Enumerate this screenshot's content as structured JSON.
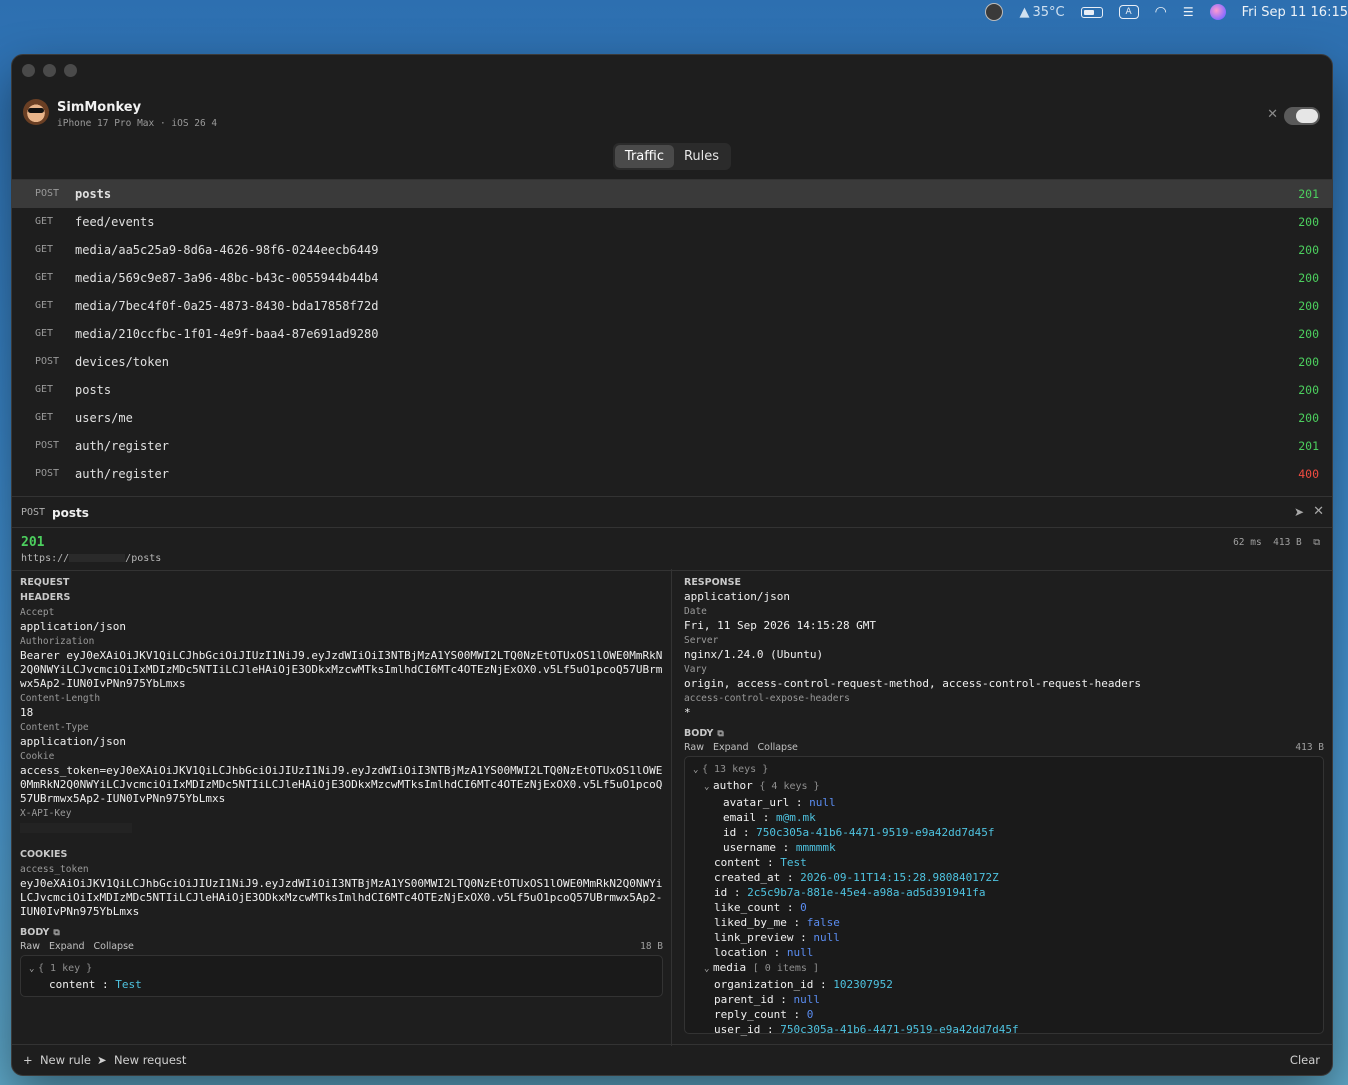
{
  "menubar": {
    "temperature": "35°C",
    "input_source": "A",
    "datetime": "Fri Sep 11  16:15"
  },
  "app": {
    "name": "SimMonkey",
    "device": "iPhone 17 Pro Max · iOS 26 4"
  },
  "tabs": [
    {
      "label": "Traffic",
      "active": true
    },
    {
      "label": "Rules",
      "active": false
    }
  ],
  "traffic": [
    {
      "method": "POST",
      "path": "posts",
      "status": "201"
    },
    {
      "method": "GET",
      "path": "feed/events",
      "status": "200"
    },
    {
      "method": "GET",
      "path": "media/aa5c25a9-8d6a-4626-98f6-0244eecb6449",
      "status": "200"
    },
    {
      "method": "GET",
      "path": "media/569c9e87-3a96-48bc-b43c-0055944b44b4",
      "status": "200"
    },
    {
      "method": "GET",
      "path": "media/7bec4f0f-0a25-4873-8430-bda17858f72d",
      "status": "200"
    },
    {
      "method": "GET",
      "path": "media/210ccfbc-1f01-4e9f-baa4-87e691ad9280",
      "status": "200"
    },
    {
      "method": "POST",
      "path": "devices/token",
      "status": "200"
    },
    {
      "method": "GET",
      "path": "posts",
      "status": "200"
    },
    {
      "method": "GET",
      "path": "users/me",
      "status": "200"
    },
    {
      "method": "POST",
      "path": "auth/register",
      "status": "201"
    },
    {
      "method": "POST",
      "path": "auth/register",
      "status": "400"
    }
  ],
  "detail": {
    "method": "POST",
    "path": "posts",
    "status": "201",
    "url_prefix": "https://",
    "url_suffix": "/posts",
    "duration": "62 ms",
    "size": "413 B"
  },
  "request": {
    "title": "REQUEST",
    "headers_title": "HEADERS",
    "headers": [
      {
        "key": "Accept",
        "value": "application/json"
      },
      {
        "key": "Authorization",
        "value": "Bearer eyJ0eXAiOiJKV1QiLCJhbGciOiJIUzI1NiJ9.eyJzdWIiOiI3NTBjMzA1YS00MWI2LTQ0NzEtOTUxOS1lOWE0MmRkN2Q0NWYiLCJvcmciOiIxMDIzMDc5NTIiLCJleHAiOjE3ODkxMzcwMTksImlhdCI6MTc4OTEzNjExOX0.v5Lf5uO1pcoQ57UBrmwx5Ap2-IUN0IvPNn975YbLmxs"
      },
      {
        "key": "Content-Length",
        "value": "18"
      },
      {
        "key": "Content-Type",
        "value": "application/json"
      },
      {
        "key": "Cookie",
        "value": "access_token=eyJ0eXAiOiJKV1QiLCJhbGciOiJIUzI1NiJ9.eyJzdWIiOiI3NTBjMzA1YS00MWI2LTQ0NzEtOTUxOS1lOWE0MmRkN2Q0NWYiLCJvcmciOiIxMDIzMDc5NTIiLCJleHAiOjE3ODkxMzcwMTksImlhdCI6MTc4OTEzNjExOX0.v5Lf5uO1pcoQ57UBrmwx5Ap2-IUN0IvPNn975YbLmxs"
      },
      {
        "key": "X-API-Key",
        "value": ""
      }
    ],
    "cookies_title": "COOKIES",
    "cookies": [
      {
        "key": "access_token",
        "value": "eyJ0eXAiOiJKV1QiLCJhbGciOiJIUzI1NiJ9.eyJzdWIiOiI3NTBjMzA1YS00MWI2LTQ0NzEtOTUxOS1lOWE0MmRkN2Q0NWYiLCJvcmciOiIxMDIzMDc5NTIiLCJleHAiOjE3ODkxMzcwMTksImlhdCI6MTc4OTEzNjExOX0.v5Lf5uO1pcoQ57UBrmwx5Ap2-IUN0IvPNn975YbLmxs"
      }
    ],
    "body_title": "BODY",
    "body_actions": [
      "Raw",
      "Expand",
      "Collapse"
    ],
    "body_size": "18 B",
    "body_summary": "{ 1 key }",
    "body": [
      {
        "key": "content",
        "value": "Test"
      }
    ]
  },
  "response": {
    "title": "RESPONSE",
    "content_type": "application/json",
    "headers": [
      {
        "key": "Date",
        "value": "Fri, 11 Sep 2026 14:15:28 GMT"
      },
      {
        "key": "Server",
        "value": "nginx/1.24.0 (Ubuntu)"
      },
      {
        "key": "Vary",
        "value": "origin, access-control-request-method, access-control-request-headers"
      },
      {
        "key": "access-control-expose-headers",
        "value": "*"
      }
    ],
    "body_title": "BODY",
    "body_actions": [
      "Raw",
      "Expand",
      "Collapse"
    ],
    "body_size": "413 B",
    "root_summary": "{ 13 keys }",
    "author_key": "author",
    "author_summary": "{ 4 keys }",
    "author": [
      {
        "key": "avatar_url",
        "value": "null",
        "type": "null"
      },
      {
        "key": "email",
        "value": "m@m.mk",
        "type": "str"
      },
      {
        "key": "id",
        "value": "750c305a-41b6-4471-9519-e9a42dd7d45f",
        "type": "str"
      },
      {
        "key": "username",
        "value": "mmmmmk",
        "type": "str"
      }
    ],
    "fields_a": [
      {
        "key": "content",
        "value": "Test",
        "type": "str"
      },
      {
        "key": "created_at",
        "value": "2026-09-11T14:15:28.980840172Z",
        "type": "str"
      },
      {
        "key": "id",
        "value": "2c5c9b7a-881e-45e4-a98a-ad5d391941fa",
        "type": "str"
      },
      {
        "key": "like_count",
        "value": "0",
        "type": "num"
      },
      {
        "key": "liked_by_me",
        "value": "false",
        "type": "bool"
      },
      {
        "key": "link_preview",
        "value": "null",
        "type": "null"
      },
      {
        "key": "location",
        "value": "null",
        "type": "null"
      }
    ],
    "media_key": "media",
    "media_summary": "[ 0 items ]",
    "fields_b": [
      {
        "key": "organization_id",
        "value": "102307952",
        "type": "str"
      },
      {
        "key": "parent_id",
        "value": "null",
        "type": "null"
      },
      {
        "key": "reply_count",
        "value": "0",
        "type": "num"
      },
      {
        "key": "user_id",
        "value": "750c305a-41b6-4471-9519-e9a42dd7d45f",
        "type": "str"
      }
    ]
  },
  "footer": {
    "new_rule": "New rule",
    "new_request": "New request",
    "clear": "Clear"
  }
}
